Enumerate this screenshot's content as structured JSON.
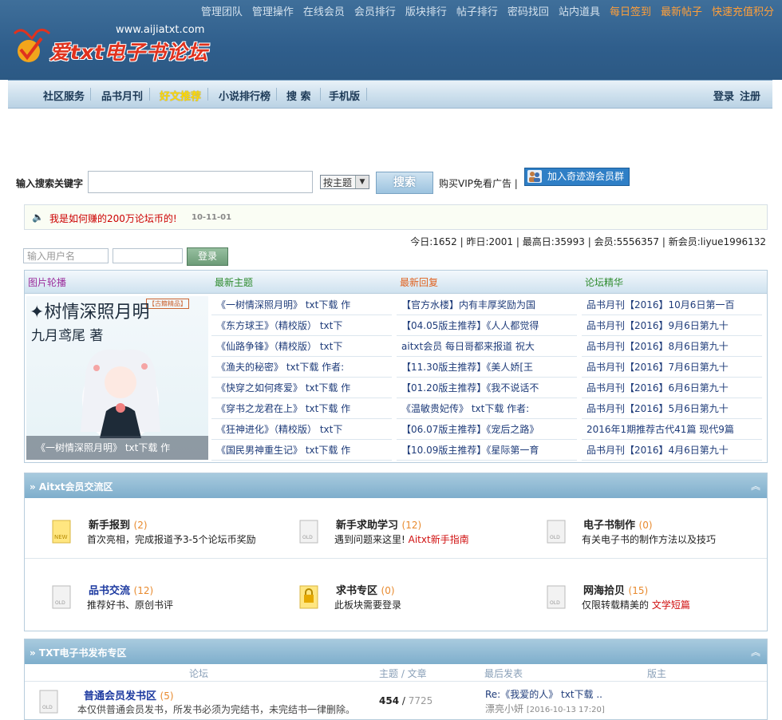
{
  "top_links": [
    {
      "label": "管理团队",
      "hl": false
    },
    {
      "label": "管理操作",
      "hl": false
    },
    {
      "label": "在线会员",
      "hl": false
    },
    {
      "label": "会员排行",
      "hl": false
    },
    {
      "label": "版块排行",
      "hl": false
    },
    {
      "label": "帖子排行",
      "hl": false
    },
    {
      "label": "密码找回",
      "hl": false
    },
    {
      "label": "站内道具",
      "hl": false
    },
    {
      "label": "每日签到",
      "hl": true
    },
    {
      "label": "最新帖子",
      "hl": true
    },
    {
      "label": "快速充值积分",
      "hl": true
    }
  ],
  "logo": {
    "url": "www.aijiatxt.com",
    "text": "爱txt电子书论坛"
  },
  "nav": {
    "items": [
      "社区服务",
      "品书月刊",
      "好文推荐",
      "小说排行榜",
      "搜 索",
      "手机版"
    ],
    "login": "登录",
    "register": "注册"
  },
  "search": {
    "label": "输入搜索关键字",
    "select": "按主题",
    "button": "搜索",
    "vip": "购买VIP免看广告 |",
    "qq": "加入奇迹游会员群"
  },
  "notice": {
    "text": "我是如何赚的200万论坛币的!",
    "date": "10-11-01"
  },
  "stats": "今日:1652 | 昨日:2001 | 最高日:35993 | 会员:5556357 | 新会员:liyue1996132",
  "login_form": {
    "user_placeholder": "输入用户名",
    "button": "登录"
  },
  "columns": {
    "titles": [
      "图片轮播",
      "最新主题",
      "最新回复",
      "论坛精华"
    ],
    "slide": {
      "tag": "【古籍精品】",
      "title": "树情深照月明",
      "author": "九月鸢尾 著",
      "caption": "《一树情深照月明》 txt下载 作"
    },
    "latest_topics": [
      "《一树情深照月明》 txt下载 作",
      "《东方球王》（精校版） txt下",
      "《仙路争锋》（精校版） txt下",
      "《渔夫的秘密》 txt下载 作者:",
      "《快穿之如何疼爱》 txt下载 作",
      "《穿书之龙君在上》 txt下载 作",
      "《狂神进化》（精校版） txt下",
      "《国民男神重生记》 txt下载 作"
    ],
    "latest_replies": [
      "【官方水楼】内有丰厚奖励为国",
      "【04.05版主推荐】《人人都觉得",
      "aitxt会员 每日哥都来报道 祝大",
      "【11.30版主推荐】《美人娇[王",
      "【01.20版主推荐】《我不说话不",
      "《温敏贵妃传》 txt下载 作者:",
      "【06.07版主推荐】《宠后之路》",
      "【10.09版主推荐】《星际第一育"
    ],
    "digest": [
      "品书月刊【2016】10月6日第一百",
      "品书月刊【2016】9月6日第九十",
      "品书月刊【2016】8月6日第九十",
      "品书月刊【2016】7月6日第九十",
      "品书月刊【2016】6月6日第九十",
      "品书月刊【2016】5月6日第九十",
      "2016年1期推荐古代41篇 现代9篇",
      "品书月刊【2016】4月6日第九十"
    ]
  },
  "section1": {
    "title": "» Aitxt会员交流区",
    "fold": "☆",
    "forums": [
      {
        "name": "新手报到",
        "count": "(2)",
        "desc": "首次亮相，完成报道予3-5个论坛币奖励",
        "desc_red": "",
        "icon": "new-folder-icon",
        "blue": false
      },
      {
        "name": "新手求助学习",
        "count": "(12)",
        "desc": "遇到问题来这里!",
        "desc_red": "Aitxt新手指南",
        "icon": "folder-icon",
        "blue": false
      },
      {
        "name": "电子书制作",
        "count": "(0)",
        "desc": "有关电子书的制作方法以及技巧",
        "desc_red": "",
        "icon": "folder-icon",
        "blue": false
      },
      {
        "name": "品书交流",
        "count": "(12)",
        "desc": "推荐好书、原创书评",
        "desc_red": "",
        "icon": "folder-icon",
        "blue": true
      },
      {
        "name": "求书专区",
        "count": "(0)",
        "desc": "此板块需要登录",
        "desc_red": "",
        "icon": "locked-folder-icon",
        "blue": false
      },
      {
        "name": "网海拾贝",
        "count": "(15)",
        "desc": "仅限转载精美的",
        "desc_red": "文学短篇",
        "icon": "folder-icon",
        "blue": false
      }
    ]
  },
  "section2": {
    "title": "» TXT电子书发布专区",
    "fold": "☆",
    "headers": [
      "论坛",
      "主题 / 文章",
      "最后发表",
      "版主"
    ],
    "row": {
      "name": "普通会员发书区",
      "count": "(5)",
      "desc": "本仅供普通会员发书，所发书必须为完结书，未完结书一律删除。",
      "topics": "454",
      "sep": "/",
      "posts": "7725",
      "last_title": "Re:《我爱的人》 txt下载 ..",
      "last_user": "漂亮小妍",
      "last_time": "[2016-10-13 17:20]"
    }
  }
}
